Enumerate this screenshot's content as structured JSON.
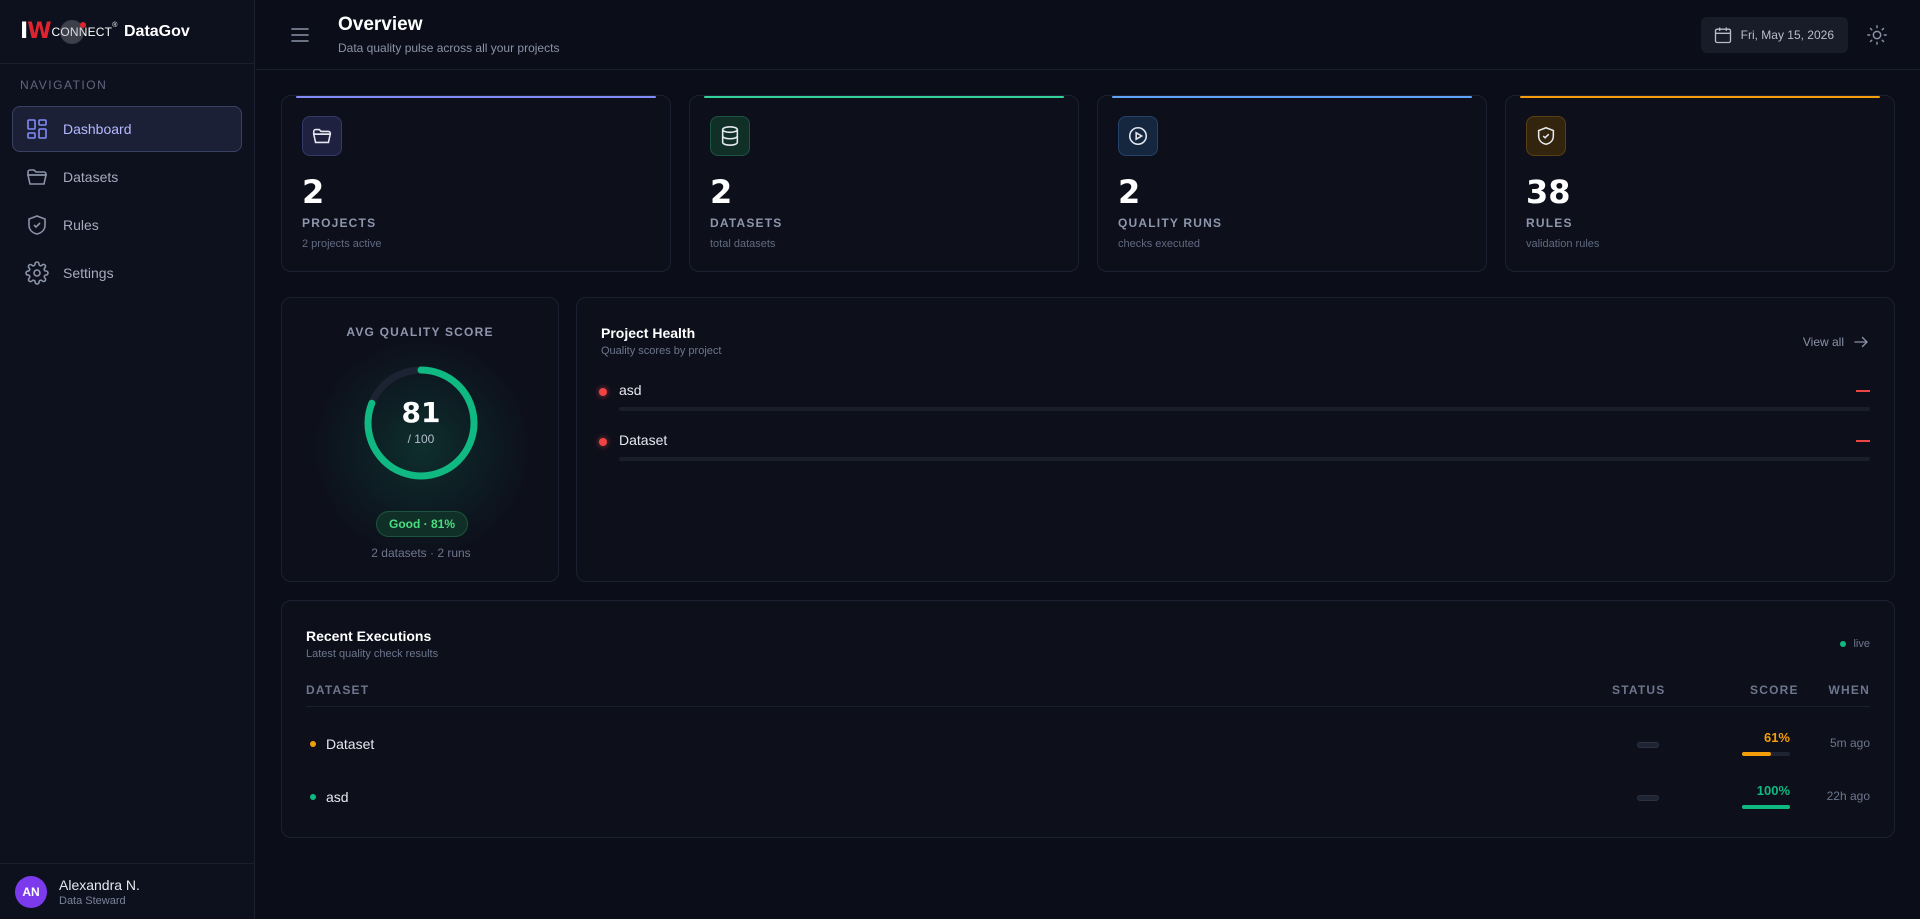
{
  "brand": {
    "logo_iw_i": "I",
    "logo_iw_w": "W",
    "logo_connect": "CONNECT",
    "logo_tm": "®",
    "name": "DataGov"
  },
  "sidebar": {
    "heading": "NAVIGATION",
    "items": [
      {
        "label": "Dashboard",
        "icon": "dashboard-icon",
        "active": true
      },
      {
        "label": "Datasets",
        "icon": "folder-icon"
      },
      {
        "label": "Rules",
        "icon": "shield-check-icon"
      },
      {
        "label": "Settings",
        "icon": "gear-icon"
      }
    ]
  },
  "user": {
    "initials": "AN",
    "name": "Alexandra N.",
    "role": "Data Steward"
  },
  "header": {
    "title": "Overview",
    "subtitle": "Data quality pulse across all your projects",
    "date": "Fri, May 15, 2026"
  },
  "stats": [
    {
      "value": "2",
      "label": "PROJECTS",
      "sub": "2 projects active",
      "icon": "folder-icon",
      "accent": "#818cf8"
    },
    {
      "value": "2",
      "label": "DATASETS",
      "sub": "total datasets",
      "icon": "database-icon",
      "accent": "#34d399"
    },
    {
      "value": "2",
      "label": "QUALITY RUNS",
      "sub": "checks executed",
      "icon": "play-circle-icon",
      "accent": "#60a5fa"
    },
    {
      "value": "38",
      "label": "RULES",
      "sub": "validation rules",
      "icon": "shield-check-icon",
      "accent": "#f59e0b"
    }
  ],
  "quality": {
    "title": "AVG QUALITY SCORE",
    "score": "81",
    "of": "/ 100",
    "fraction": 0.81,
    "badge": "Good · 81%",
    "meta": "2 datasets · 2 runs",
    "color": "#10b981"
  },
  "health": {
    "title": "Project Health",
    "subtitle": "Quality scores by project",
    "view_all": "View all",
    "rows": [
      {
        "name": "asd"
      },
      {
        "name": "Dataset"
      }
    ]
  },
  "recent": {
    "title": "Recent Executions",
    "subtitle": "Latest quality check results",
    "live": "live",
    "columns": {
      "dataset": "DATASET",
      "status": "STATUS",
      "score": "SCORE",
      "when": "WHEN"
    },
    "rows": [
      {
        "dataset": "Dataset",
        "score": "61%",
        "fraction": 0.61,
        "when": "5m ago",
        "color": "#f59e0b"
      },
      {
        "dataset": "asd",
        "score": "100%",
        "fraction": 1.0,
        "when": "22h ago",
        "color": "#10b981"
      }
    ]
  }
}
